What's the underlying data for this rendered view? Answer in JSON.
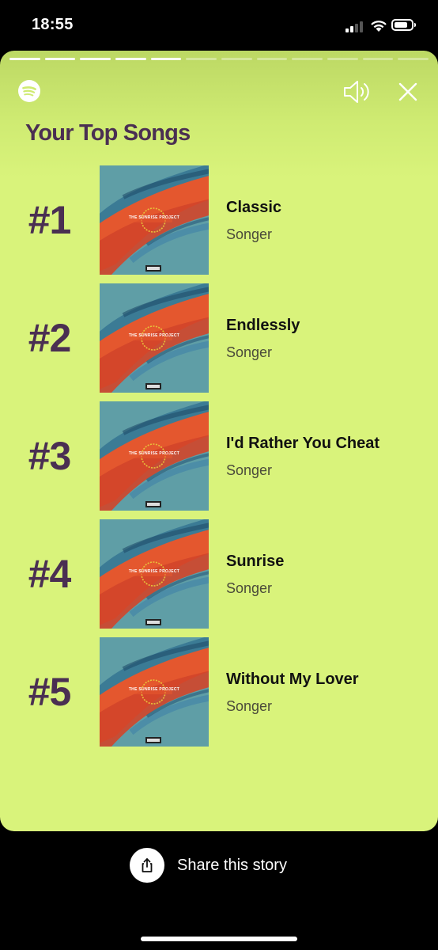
{
  "status_bar": {
    "time": "18:55"
  },
  "story": {
    "progress_total": 12,
    "progress_done": 5,
    "title": "Your Top Songs",
    "songs": [
      {
        "rank": "#1",
        "title": "Classic",
        "artist": "Songer",
        "album_text": "THE SUNRISE PROJECT"
      },
      {
        "rank": "#2",
        "title": "Endlessly",
        "artist": "Songer",
        "album_text": "THE SUNRISE PROJECT"
      },
      {
        "rank": "#3",
        "title": "I'd Rather You Cheat",
        "artist": "Songer",
        "album_text": "THE SUNRISE PROJECT"
      },
      {
        "rank": "#4",
        "title": "Sunrise",
        "artist": "Songer",
        "album_text": "THE SUNRISE PROJECT"
      },
      {
        "rank": "#5",
        "title": "Without My Lover",
        "artist": "Songer",
        "album_text": "THE SUNRISE PROJECT"
      }
    ]
  },
  "share": {
    "label": "Share this story"
  },
  "icons": {
    "logo": "spotify-logo-icon",
    "volume": "speaker-icon",
    "close": "close-icon",
    "share": "share-icon"
  },
  "colors": {
    "story_background": "#d9f37b",
    "title_color": "#4a2f52",
    "cover_teal": "#5f9ea6",
    "cover_orange": "#e4572e"
  }
}
